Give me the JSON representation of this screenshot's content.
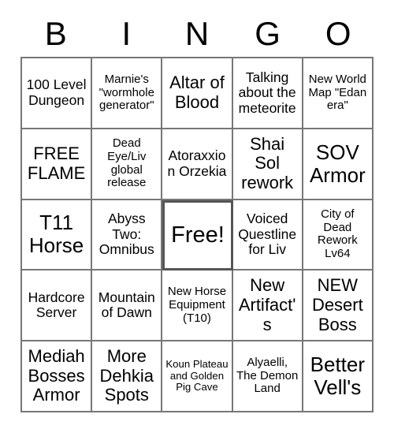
{
  "header": {
    "letters": [
      "B",
      "I",
      "N",
      "G",
      "O"
    ]
  },
  "grid": {
    "rows": [
      {
        "cells": [
          {
            "text": "100 Level Dungeon",
            "size": "md"
          },
          {
            "text": "Marnie's \"wormhole generator\"",
            "size": "sm"
          },
          {
            "text": "Altar of Blood",
            "size": "lg"
          },
          {
            "text": "Talking about the meteorite",
            "size": "md"
          },
          {
            "text": "New World Map \"Edan era\"",
            "size": "sm"
          }
        ]
      },
      {
        "cells": [
          {
            "text": "FREE FLAME",
            "size": "lg"
          },
          {
            "text": "Dead Eye/Liv global release",
            "size": "sm"
          },
          {
            "text": "Atoraxxion Orzekia",
            "size": "md"
          },
          {
            "text": "Shai Sol rework",
            "size": "lg"
          },
          {
            "text": "SOV Armor",
            "size": "xl"
          }
        ]
      },
      {
        "cells": [
          {
            "text": "T11 Horse",
            "size": "xl"
          },
          {
            "text": "Abyss Two: Omnibus",
            "size": "md"
          },
          {
            "text": "Free!",
            "size": "free",
            "free": true
          },
          {
            "text": "Voiced Questline for Liv",
            "size": "md"
          },
          {
            "text": "City of Dead Rework Lv64",
            "size": "sm"
          }
        ]
      },
      {
        "cells": [
          {
            "text": "Hardcore Server",
            "size": "md"
          },
          {
            "text": "Mountain of Dawn",
            "size": "md"
          },
          {
            "text": "New Horse Equipment (T10)",
            "size": "sm"
          },
          {
            "text": "New Artifact's",
            "size": "lg"
          },
          {
            "text": "NEW Desert Boss",
            "size": "lg"
          }
        ]
      },
      {
        "cells": [
          {
            "text": "Mediah Bosses Armor",
            "size": "lg"
          },
          {
            "text": "More Dehkia Spots",
            "size": "lg"
          },
          {
            "text": "Koun Plateau and Golden Pig Cave",
            "size": "xs"
          },
          {
            "text": "Alyaelli, The Demon Land",
            "size": "sm"
          },
          {
            "text": "Better Vell's",
            "size": "xl"
          }
        ]
      }
    ]
  },
  "colors": {
    "border": "#777777",
    "free_border": "#555555",
    "text": "#000000",
    "background": "#ffffff"
  }
}
